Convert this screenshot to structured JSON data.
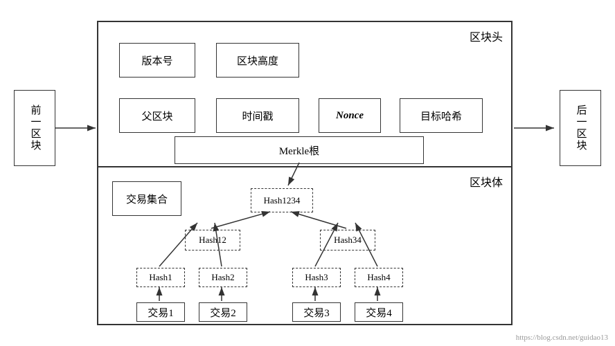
{
  "prev_block": {
    "label": "前一区块",
    "writing": "vertical"
  },
  "next_block": {
    "label": "后一区块",
    "writing": "vertical"
  },
  "block_header": {
    "label": "区块头",
    "version": "版本号",
    "height": "区块高度",
    "parent": "父区块",
    "timestamp": "时间戳",
    "nonce": "Nonce",
    "target": "目标哈希",
    "merkle": "Merkle根"
  },
  "block_body": {
    "label": "区块体",
    "txset": "交易集合",
    "hash1234": "Hash1234",
    "hash12": "Hash12",
    "hash34": "Hash34",
    "hash1": "Hash1",
    "hash2": "Hash2",
    "hash3": "Hash3",
    "hash4": "Hash4",
    "tx1": "交易1",
    "tx2": "交易2",
    "tx3": "交易3",
    "tx4": "交易4"
  },
  "watermark": "https://blog.csdn.net/guidao13"
}
